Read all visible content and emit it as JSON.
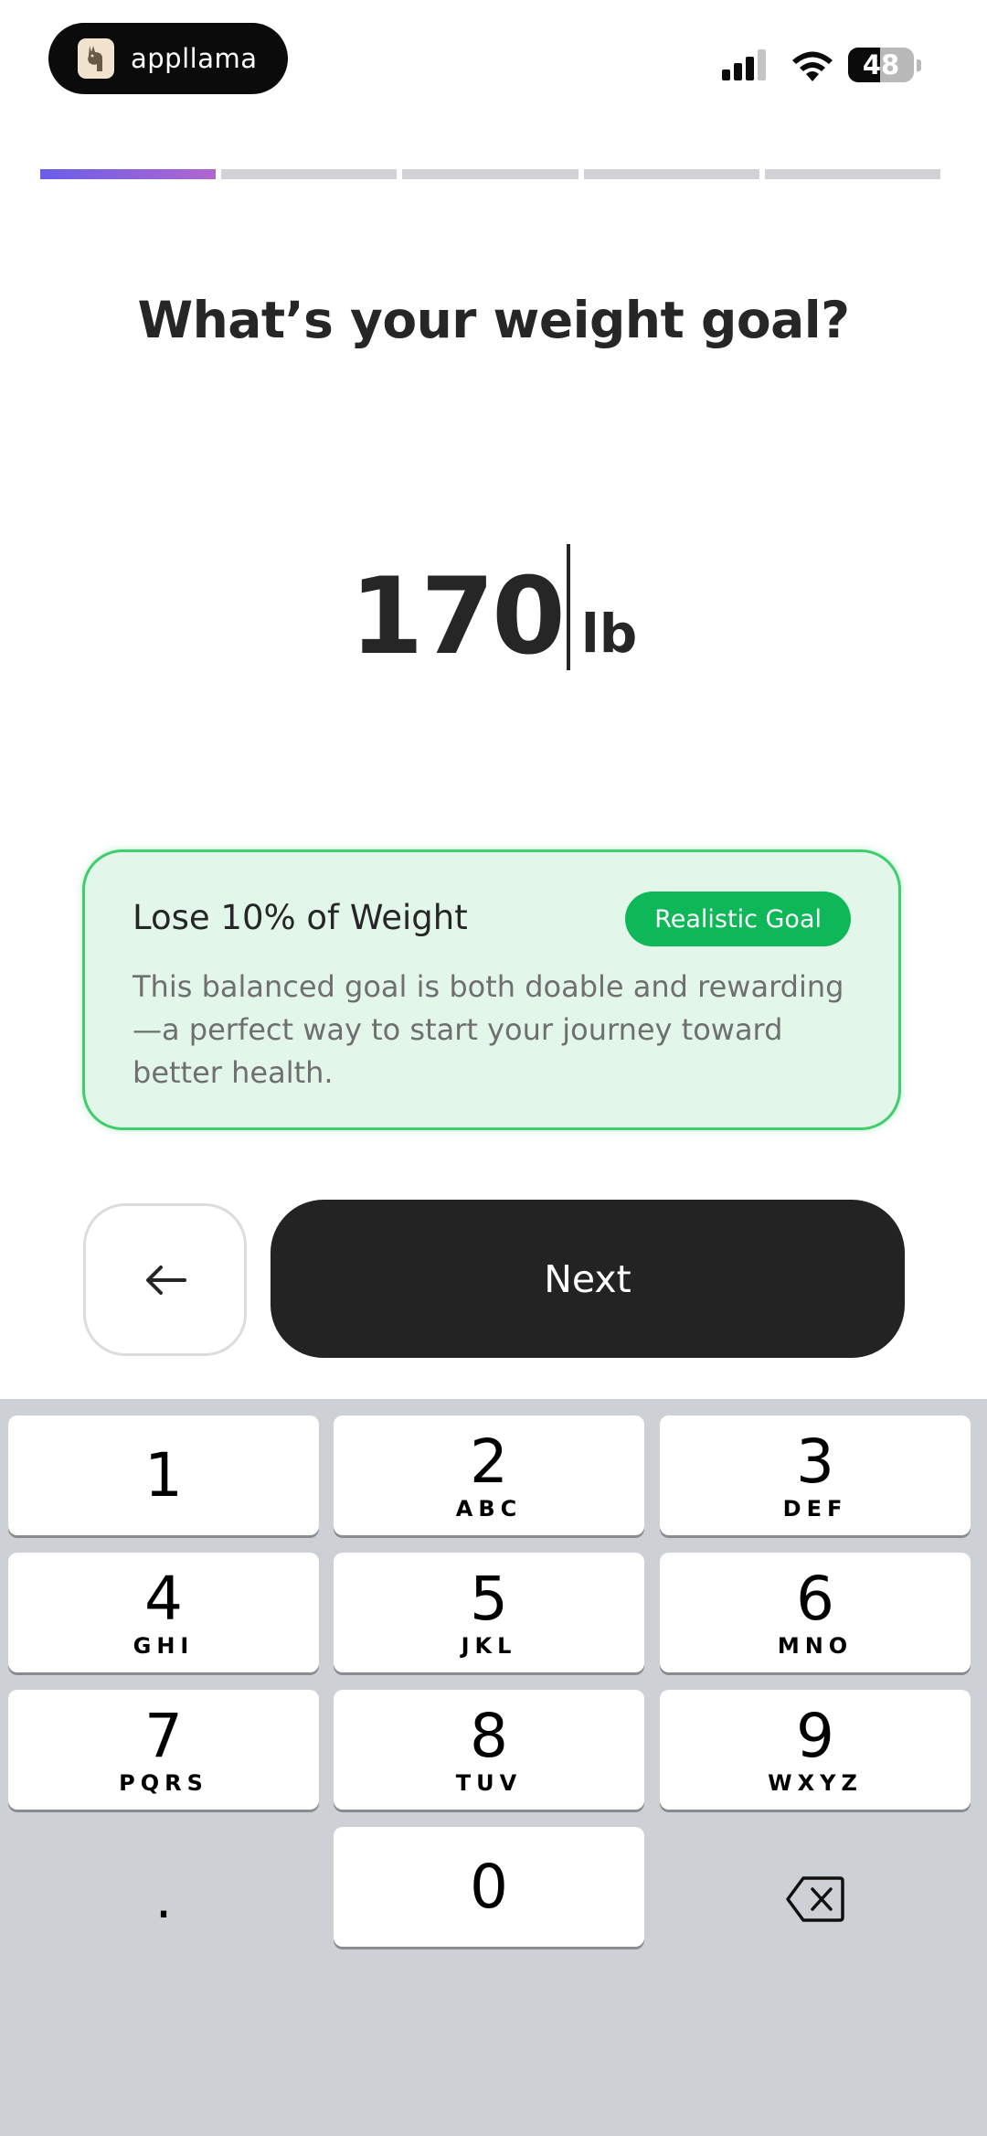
{
  "status_bar": {
    "app_pill_label": "appllama",
    "battery_level": "48",
    "battery_fraction": 0.48
  },
  "progress": {
    "total_steps": 5,
    "current_step": 1
  },
  "question": {
    "title": "What’s your weight goal?"
  },
  "weight": {
    "value": "170",
    "unit": "lb"
  },
  "goal_card": {
    "title": "Lose 10% of Weight",
    "badge": "Realistic Goal",
    "description": "This balanced goal is both doable and rewarding—a perfect way to start your journey toward better health."
  },
  "actions": {
    "back_icon": "arrow-left-icon",
    "next_label": "Next"
  },
  "keypad": {
    "keys": [
      {
        "num": "1",
        "letters": ""
      },
      {
        "num": "2",
        "letters": "ABC"
      },
      {
        "num": "3",
        "letters": "DEF"
      },
      {
        "num": "4",
        "letters": "GHI"
      },
      {
        "num": "5",
        "letters": "JKL"
      },
      {
        "num": "6",
        "letters": "MNO"
      },
      {
        "num": "7",
        "letters": "PQRS"
      },
      {
        "num": "8",
        "letters": "TUV"
      },
      {
        "num": "9",
        "letters": "WXYZ"
      },
      {
        "num": "0",
        "letters": ""
      }
    ],
    "decimal_label": ".",
    "delete_icon": "backspace-icon"
  },
  "colors": {
    "accent_gradient_start": "#6a5ee8",
    "accent_gradient_end": "#b066cf",
    "success_green": "#0eb758",
    "card_bg": "#e3f6ea",
    "dark_button": "#242323"
  }
}
